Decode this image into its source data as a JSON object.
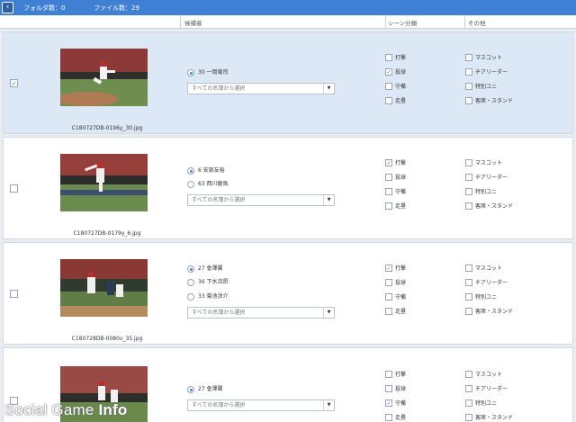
{
  "header": {
    "back_icon": "chevron-left-icon",
    "folder_count": "フォルダ数：0",
    "file_count": "ファイル数：29"
  },
  "columns": {
    "candidates": "候補者",
    "scene": "シーン分類",
    "other": "その他"
  },
  "select_placeholder": "すべての名簿から選択",
  "scene_labels": [
    "打撃",
    "投球",
    "守備",
    "走塁"
  ],
  "other_labels": [
    "マスコット",
    "チアリーダー",
    "特別ユニ",
    "客席・スタンド"
  ],
  "rows": [
    {
      "filename": "C180727DB-0196y_30.jpg",
      "checked": true,
      "candidates": [
        {
          "label": "30 一岡竜司",
          "selected": true
        }
      ],
      "scene_checked": [
        false,
        true,
        false,
        false
      ],
      "other_checked": [
        false,
        false,
        false,
        false
      ]
    },
    {
      "filename": "C180727DB-0179y_6.jpg",
      "checked": false,
      "candidates": [
        {
          "label": "6 安部友裕",
          "selected": true
        },
        {
          "label": "63 西川龍馬",
          "selected": false
        }
      ],
      "scene_checked": [
        true,
        false,
        false,
        false
      ],
      "other_checked": [
        false,
        false,
        false,
        false
      ]
    },
    {
      "filename": "C180728DB-0080v_35.jpg",
      "checked": false,
      "candidates": [
        {
          "label": "27 會澤翼",
          "selected": true
        },
        {
          "label": "36 下水流昂",
          "selected": false
        },
        {
          "label": "33 菊池涼介",
          "selected": false
        }
      ],
      "scene_checked": [
        true,
        false,
        false,
        false
      ],
      "other_checked": [
        false,
        false,
        false,
        false
      ]
    },
    {
      "filename": "",
      "checked": false,
      "candidates": [
        {
          "label": "27 會澤翼",
          "selected": true
        }
      ],
      "scene_checked": [
        false,
        false,
        true,
        false
      ],
      "other_checked": [
        false,
        false,
        false,
        false
      ]
    }
  ],
  "watermark": {
    "part1": "Social Game ",
    "part2": "Info"
  },
  "colors": {
    "header_bar": "#3f7fd4",
    "selected_row": "#dde8f6",
    "check": "#2a7fd8"
  }
}
